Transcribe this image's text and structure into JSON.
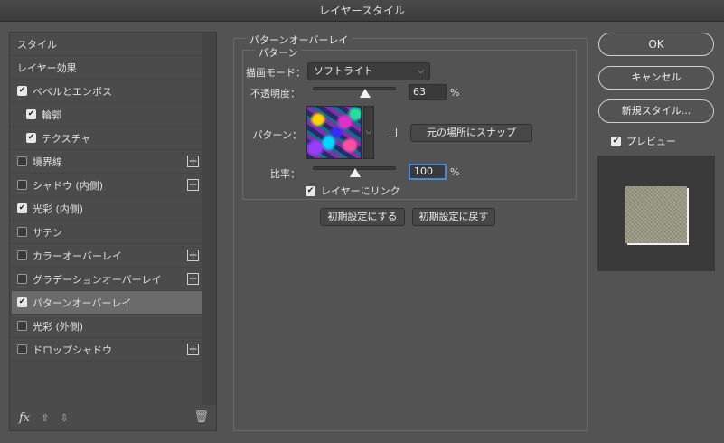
{
  "window": {
    "title": "レイヤースタイル"
  },
  "left": {
    "items": [
      {
        "label": "スタイル",
        "checkbox": false,
        "checked": false,
        "plus": false,
        "indent": false
      },
      {
        "label": "レイヤー効果",
        "checkbox": false,
        "checked": false,
        "plus": false,
        "indent": false
      },
      {
        "label": "ベベルとエンボス",
        "checkbox": true,
        "checked": true,
        "plus": false,
        "indent": false
      },
      {
        "label": "輪郭",
        "checkbox": true,
        "checked": true,
        "plus": false,
        "indent": true
      },
      {
        "label": "テクスチャ",
        "checkbox": true,
        "checked": true,
        "plus": false,
        "indent": true
      },
      {
        "label": "境界線",
        "checkbox": true,
        "checked": false,
        "plus": true,
        "indent": false
      },
      {
        "label": "シャドウ (内側)",
        "checkbox": true,
        "checked": false,
        "plus": true,
        "indent": false
      },
      {
        "label": "光彩 (内側)",
        "checkbox": true,
        "checked": true,
        "plus": false,
        "indent": false
      },
      {
        "label": "サテン",
        "checkbox": true,
        "checked": false,
        "plus": false,
        "indent": false
      },
      {
        "label": "カラーオーバーレイ",
        "checkbox": true,
        "checked": false,
        "plus": true,
        "indent": false
      },
      {
        "label": "グラデーションオーバーレイ",
        "checkbox": true,
        "checked": false,
        "plus": true,
        "indent": false
      },
      {
        "label": "パターンオーバーレイ",
        "checkbox": true,
        "checked": true,
        "plus": false,
        "indent": false,
        "selected": true
      },
      {
        "label": "光彩 (外側)",
        "checkbox": true,
        "checked": false,
        "plus": false,
        "indent": false
      },
      {
        "label": "ドロップシャドウ",
        "checkbox": true,
        "checked": false,
        "plus": true,
        "indent": false
      }
    ],
    "footer": {
      "fx": "fx"
    }
  },
  "panel": {
    "group_title": "パターンオーバーレイ",
    "sub_title": "パターン",
    "blend_label": "描画モード：",
    "blend_value": "ソフトライト",
    "opacity_label": "不透明度：",
    "opacity_value": "63",
    "opacity_fraction": 0.63,
    "unit": "%",
    "pattern_label": "パターン：",
    "snap_button": "元の場所にスナップ",
    "scale_label": "比率：",
    "scale_value": "100",
    "link_label": "レイヤーにリンク",
    "link_checked": true,
    "default_set": "初期設定にする",
    "default_reset": "初期設定に戻す"
  },
  "right": {
    "ok": "OK",
    "cancel": "キャンセル",
    "new_style": "新規スタイル...",
    "preview_label": "プレビュー",
    "preview_checked": true
  }
}
